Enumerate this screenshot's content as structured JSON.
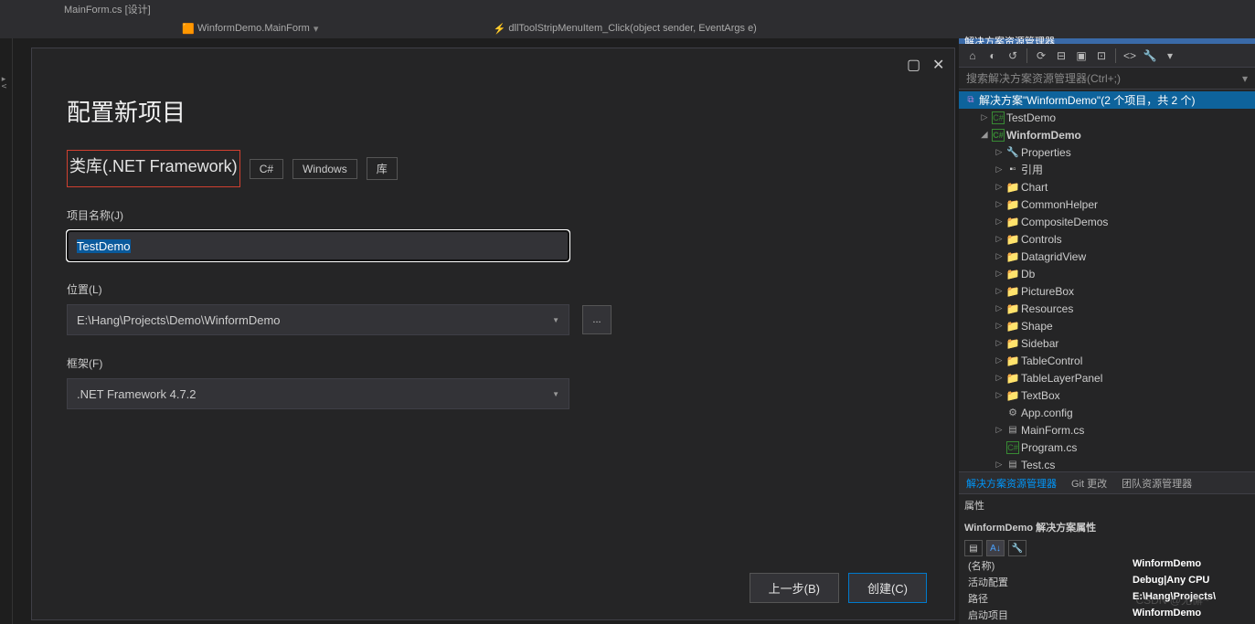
{
  "topbar": {
    "file": "MainForm.cs [设计]"
  },
  "tabs": [
    {
      "icon": "form-icon",
      "label": "WinformDemo.MainForm"
    },
    {
      "icon": "lightning-icon",
      "label": "dllToolStripMenuItem_Click(object sender, EventArgs e)"
    }
  ],
  "dialog": {
    "title": "配置新项目",
    "subtitle": "类库(.NET Framework)",
    "tags": [
      "C#",
      "Windows",
      "库"
    ],
    "projectNameLabel": "项目名称(J)",
    "projectName": "TestDemo",
    "locationLabel": "位置(L)",
    "location": "E:\\Hang\\Projects\\Demo\\WinformDemo",
    "browse": "...",
    "frameworkLabel": "框架(F)",
    "framework": ".NET Framework 4.7.2",
    "back": "上一步(B)",
    "create": "创建(C)"
  },
  "solutionExplorer": {
    "header": "解决方案资源管理器",
    "searchPlaceholder": "搜索解决方案资源管理器(Ctrl+;)",
    "solution": "解决方案\"WinformDemo\"(2 个项目，共 2 个)",
    "nodes": [
      {
        "type": "proj",
        "label": "TestDemo",
        "indent": 1,
        "tw": "▷"
      },
      {
        "type": "proj",
        "label": "WinformDemo",
        "indent": 1,
        "tw": "◢",
        "bold": true
      },
      {
        "type": "props",
        "label": "Properties",
        "indent": 2,
        "tw": "▷"
      },
      {
        "type": "ref",
        "label": "引用",
        "indent": 2,
        "tw": "▷"
      },
      {
        "type": "folder",
        "label": "Chart",
        "indent": 2,
        "tw": "▷"
      },
      {
        "type": "folder",
        "label": "CommonHelper",
        "indent": 2,
        "tw": "▷"
      },
      {
        "type": "folder",
        "label": "CompositeDemos",
        "indent": 2,
        "tw": "▷"
      },
      {
        "type": "folder",
        "label": "Controls",
        "indent": 2,
        "tw": "▷"
      },
      {
        "type": "folder",
        "label": "DatagridView",
        "indent": 2,
        "tw": "▷"
      },
      {
        "type": "folder",
        "label": "Db",
        "indent": 2,
        "tw": "▷"
      },
      {
        "type": "folder",
        "label": "PictureBox",
        "indent": 2,
        "tw": "▷"
      },
      {
        "type": "folder",
        "label": "Resources",
        "indent": 2,
        "tw": "▷"
      },
      {
        "type": "folder",
        "label": "Shape",
        "indent": 2,
        "tw": "▷"
      },
      {
        "type": "folder",
        "label": "Sidebar",
        "indent": 2,
        "tw": "▷"
      },
      {
        "type": "folder",
        "label": "TableControl",
        "indent": 2,
        "tw": "▷"
      },
      {
        "type": "folder",
        "label": "TableLayerPanel",
        "indent": 2,
        "tw": "▷"
      },
      {
        "type": "folder",
        "label": "TextBox",
        "indent": 2,
        "tw": "▷"
      },
      {
        "type": "cfg",
        "label": "App.config",
        "indent": 2,
        "tw": ""
      },
      {
        "type": "file",
        "label": "MainForm.cs",
        "indent": 2,
        "tw": "▷"
      },
      {
        "type": "cs",
        "label": "Program.cs",
        "indent": 2,
        "tw": ""
      },
      {
        "type": "file",
        "label": "Test.cs",
        "indent": 2,
        "tw": "▷"
      }
    ],
    "bottomTabs": [
      "解决方案资源管理器",
      "Git 更改",
      "团队资源管理器"
    ]
  },
  "properties": {
    "header": "属性",
    "title": "WinformDemo 解决方案属性",
    "rows": [
      {
        "key": "(名称)",
        "val": "WinformDemo"
      },
      {
        "key": "活动配置",
        "val": "Debug|Any CPU"
      },
      {
        "key": "路径",
        "val": "E:\\Hang\\Projects\\"
      },
      {
        "key": "启动项目",
        "val": "WinformDemo"
      }
    ]
  },
  "watermark": "CSDN @无懈~"
}
